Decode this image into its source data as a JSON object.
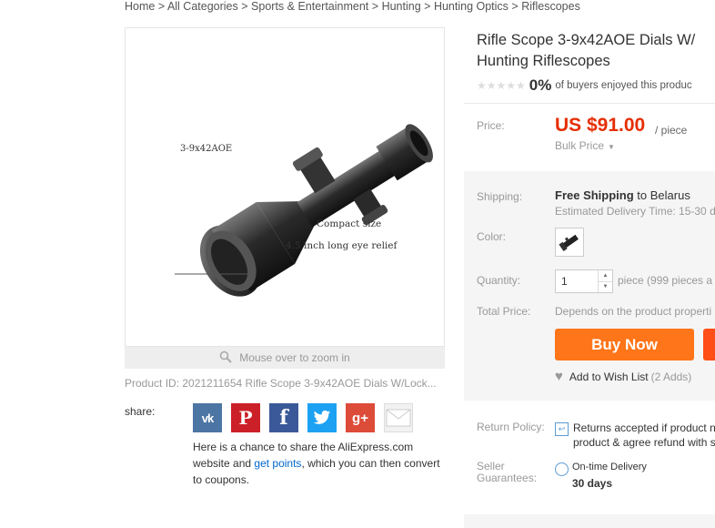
{
  "breadcrumb": {
    "home": "Home",
    "sep": ">",
    "items": [
      "All Categories",
      "Sports & Entertainment",
      "Hunting",
      "Hunting Optics",
      "Riflescopes"
    ]
  },
  "gallery": {
    "label_model": "3-9x42AOE",
    "label_compact": "Compact size",
    "label_relief": "4.5 inch long eye relief",
    "zoom_hint": "Mouse over to zoom in"
  },
  "product_id_text": "Product ID: 2021211654 Rifle Scope 3-9x42AOE Dials W/Lock...",
  "share": {
    "label": "share:",
    "buttons": [
      "VK",
      "Pinterest",
      "Facebook",
      "Twitter",
      "Google+",
      "Email"
    ],
    "text_before": "Here is a chance to share the AliExpress.com website and ",
    "link": "get points",
    "text_after": ", which you can then convert to coupons."
  },
  "product": {
    "title_line1": "Rifle Scope 3-9x42AOE Dials W/",
    "title_line2": "Hunting Riflescopes",
    "stars": "★★★★★",
    "percent": "0%",
    "rating_text": "of buyers enjoyed this produc"
  },
  "price": {
    "label": "Price:",
    "value": "US $91.00",
    "unit": "/ piece",
    "bulk": "Bulk Price"
  },
  "shipping": {
    "label": "Shipping:",
    "free": "Free Shipping",
    "dest": " to Belarus ",
    "estimate": "Estimated Delivery Time: 15-30 d"
  },
  "color": {
    "label": "Color:"
  },
  "quantity": {
    "label": "Quantity:",
    "value": "1",
    "unit": "piece (999 pieces a"
  },
  "total": {
    "label": "Total Price:",
    "text": "Depends on the product properti"
  },
  "actions": {
    "buy_now": "Buy Now",
    "wishlist": "Add to Wish List",
    "wishlist_count": "(2 Adds)"
  },
  "return_policy": {
    "label": "Return Policy:",
    "text": "Returns accepted if product n product & agree refund with s"
  },
  "guarantees": {
    "label_line1": "Seller",
    "label_line2": "Guarantees:",
    "ontime": "On-time Delivery",
    "days": "30 days"
  },
  "colors": {
    "price": "#e62e04",
    "buy_now": "#ff7519",
    "link": "#0066cc"
  }
}
